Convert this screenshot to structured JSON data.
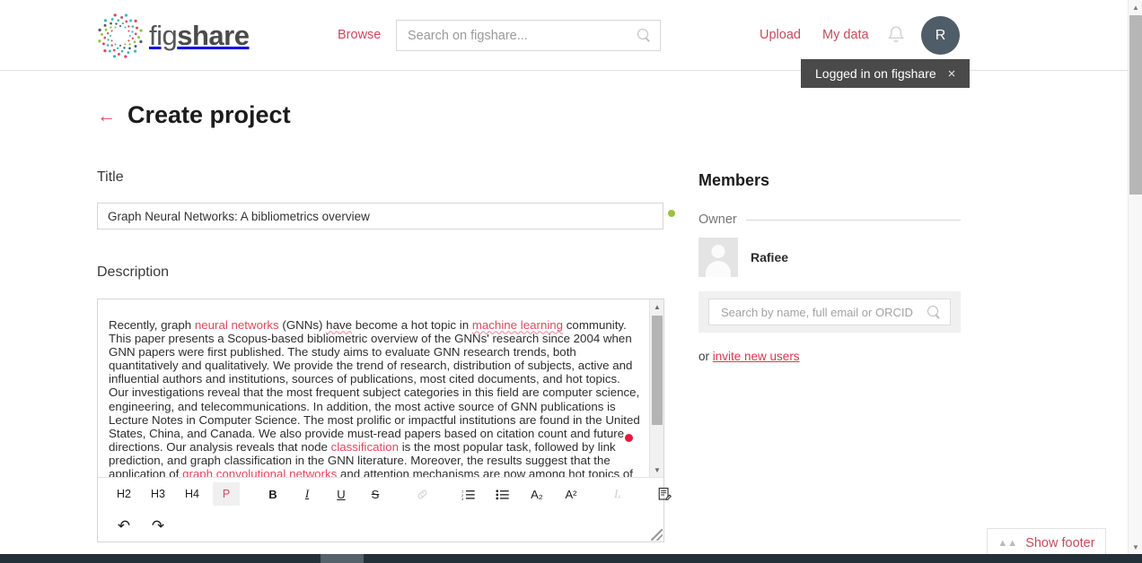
{
  "header": {
    "logo_text_fig": "fig",
    "logo_text_share": "share",
    "browse_label": "Browse",
    "search_placeholder": "Search on figshare...",
    "search_value": "",
    "upload_label": "Upload",
    "mydata_label": "My data",
    "avatar_initial": "R",
    "bell_icon": "bell-icon",
    "search_icon": "search-icon"
  },
  "toast": {
    "message": "Logged in on figshare",
    "close_icon": "×"
  },
  "page": {
    "back_icon": "←",
    "title": "Create project"
  },
  "form": {
    "title_label": "Title",
    "title_value": "Graph Neural Networks: A bibliometrics overview",
    "title_status_color": "#9ac43b",
    "description_label": "Description",
    "description_status_color": "#e8173d",
    "description_paragraph_1": "Recently, graph ",
    "description_link_1": "neural networks",
    "description_paragraph_2": " (GNNs) ",
    "description_spell_1": "have",
    "description_paragraph_3": " become a hot topic in ",
    "description_link_2": "machine learning",
    "description_paragraph_4": " community. This paper presents a Scopus-based bibliometric overview of the GNNs' research since 2004 when GNN papers were first published. The study aims to evaluate GNN research trends, both quantitatively and qualitatively. We provide the trend of research, distribution of subjects, active and influential authors and institutions, sources of publications, most cited documents, and hot topics. Our investigations reveal that the most frequent subject categories in this field are computer science, engineering, and telecommunications. In addition, the most active source of GNN publications is Lecture Notes in Computer Science. The most prolific or impactful institutions are found in the United States, China, and Canada. We also provide must-read papers based on citation count and future directions. Our analysis reveals that node ",
    "description_link_3": "classification",
    "description_paragraph_5": " is the most popular task, followed by link prediction, and graph classification in the GNN literature. Moreover, the results suggest that the application of ",
    "description_link_4": "graph convolutional networks",
    "description_paragraph_6": " and attention mechanisms are now among hot topics of"
  },
  "editor_toolbar": {
    "buttons": [
      {
        "name": "heading-2-button",
        "label": "H2",
        "active": false,
        "disabled": false
      },
      {
        "name": "heading-3-button",
        "label": "H3",
        "active": false,
        "disabled": false
      },
      {
        "name": "heading-4-button",
        "label": "H4",
        "active": false,
        "disabled": false
      },
      {
        "name": "paragraph-button",
        "label": "P",
        "active": true,
        "disabled": false
      },
      {
        "name": "bold-button",
        "label": "B",
        "active": false,
        "disabled": false
      },
      {
        "name": "italic-button",
        "label": "I",
        "active": false,
        "disabled": false
      },
      {
        "name": "underline-button",
        "label": "U",
        "active": false,
        "disabled": false
      },
      {
        "name": "strikethrough-button",
        "label": "S",
        "active": false,
        "disabled": false
      },
      {
        "name": "link-button",
        "label": "link-icon",
        "active": false,
        "disabled": true
      },
      {
        "name": "ordered-list-button",
        "label": "ordered-list-icon",
        "active": false,
        "disabled": false
      },
      {
        "name": "unordered-list-button",
        "label": "unordered-list-icon",
        "active": false,
        "disabled": false
      },
      {
        "name": "subscript-button",
        "label": "A₂",
        "active": false,
        "disabled": false
      },
      {
        "name": "superscript-button",
        "label": "A²",
        "active": false,
        "disabled": false
      },
      {
        "name": "clear-formatting-button",
        "label": "Iₓ",
        "active": false,
        "disabled": true
      },
      {
        "name": "source-edit-button",
        "label": "source-edit-icon",
        "active": false,
        "disabled": false
      },
      {
        "name": "undo-button",
        "label": "↶",
        "active": false,
        "disabled": false
      },
      {
        "name": "redo-button",
        "label": "↷",
        "active": false,
        "disabled": false
      }
    ],
    "labels": {
      "h2": "H2",
      "h3": "H3",
      "h4": "H4",
      "p": "P",
      "bold": "B",
      "italic": "I",
      "underline": "U",
      "strike": "S",
      "subscript": "A₂",
      "superscript": "A²",
      "clear": "Iₓ",
      "undo": "↶",
      "redo": "↷"
    }
  },
  "members": {
    "heading": "Members",
    "owner_label": "Owner",
    "owner_name": "Rafiee",
    "search_placeholder": "Search by name, full email or ORCID",
    "search_value": "",
    "search_icon": "search-icon",
    "invite_prefix": "or ",
    "invite_link": "invite new users"
  },
  "footer_toggle": {
    "label": "Show footer",
    "icon": "chevron-double-up-icon"
  },
  "scrollbars": {
    "up_arrow": "▲",
    "down_arrow": "▼"
  },
  "colors": {
    "brand_red": "#c74b5a",
    "accent_red": "#e0485e",
    "green_status": "#9ac43b",
    "red_status": "#e8173d",
    "avatar_bg": "#4f5d68"
  }
}
